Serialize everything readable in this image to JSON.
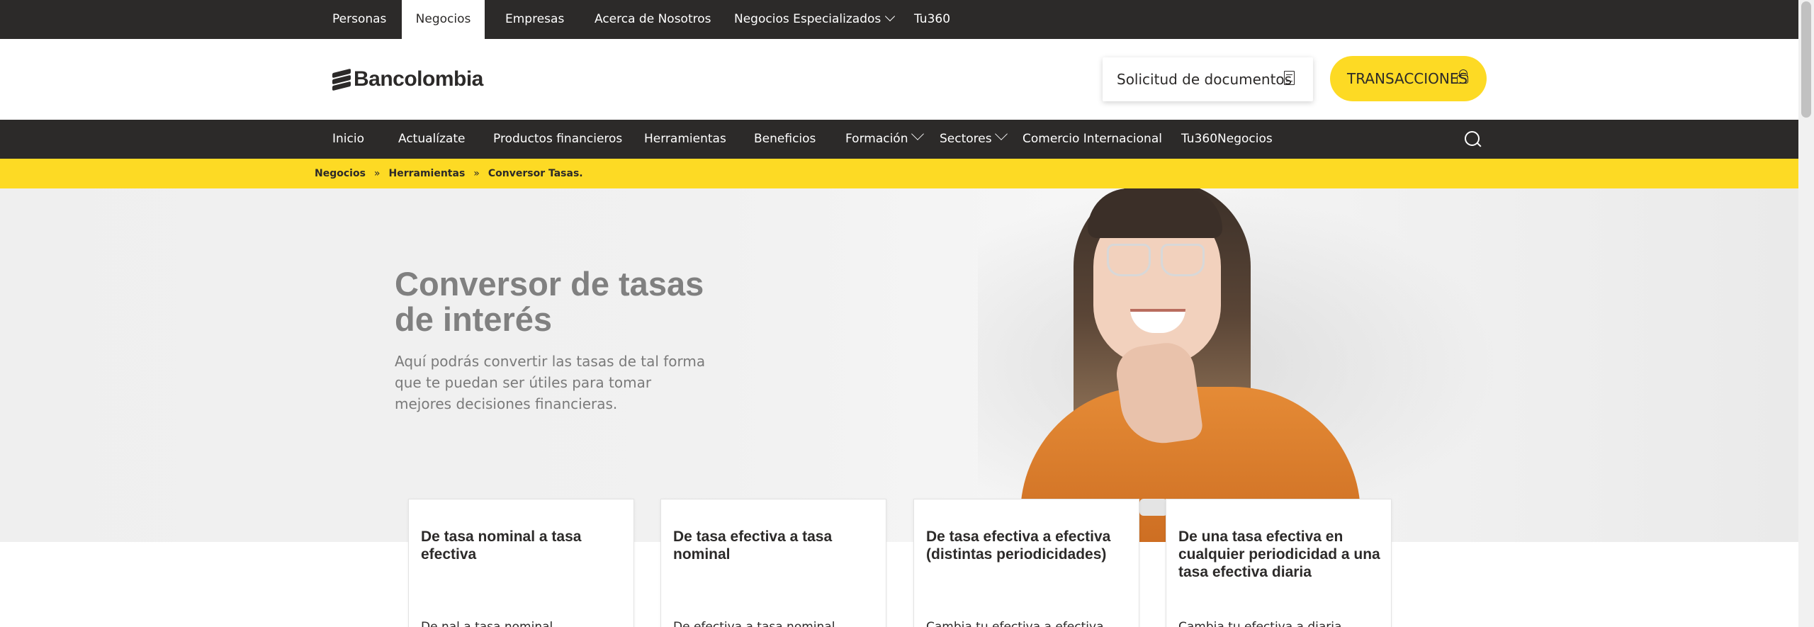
{
  "topbar": {
    "items": [
      {
        "label": "Personas",
        "active": false
      },
      {
        "label": "Negocios",
        "active": true
      },
      {
        "label": "Empresas",
        "active": false
      },
      {
        "label": "Acerca de Nosotros",
        "active": false
      },
      {
        "label": "Negocios Especializados",
        "active": false,
        "dropdown": true
      },
      {
        "label": "Tu360",
        "active": false
      }
    ]
  },
  "header": {
    "logo_text": "Bancolombia",
    "docs_button": "Solicitud de documentos",
    "transactions_button": "TRANSACCIONES"
  },
  "mainnav": {
    "items": [
      {
        "label": "Inicio"
      },
      {
        "label": "Actualízate"
      },
      {
        "label": "Productos financieros"
      },
      {
        "label": "Herramientas"
      },
      {
        "label": "Beneficios"
      },
      {
        "label": "Formación",
        "dropdown": true
      },
      {
        "label": "Sectores",
        "dropdown": true
      },
      {
        "label": "Comercio Internacional"
      },
      {
        "label": "Tu360Negocios"
      }
    ],
    "search_icon": "search-icon"
  },
  "breadcrumb": {
    "items": [
      "Negocios",
      "Herramientas",
      "Conversor Tasas."
    ],
    "separator": "»"
  },
  "hero": {
    "title": "Conversor de tasas de interés",
    "subtitle": "Aquí podrás convertir las tasas de tal forma que te puedan ser útiles para tomar mejores decisiones financieras."
  },
  "cards": [
    {
      "title": "De tasa nominal a tasa efectiva",
      "body": "De nal a tasa nominal"
    },
    {
      "title": "De tasa efectiva a tasa nominal",
      "body": "De efectiva a tasa nominal"
    },
    {
      "title": "De tasa efectiva a efectiva (distintas periodicidades)",
      "body": "Cambia tu efectiva a efectiva"
    },
    {
      "title": "De una tasa efectiva en cualquier periodicidad a una tasa efectiva diaria",
      "body": "Cambia tu efectiva a diaria"
    }
  ],
  "colors": {
    "dark": "#2c2a29",
    "brand_yellow": "#fdda24",
    "hero_text": "#808080"
  }
}
